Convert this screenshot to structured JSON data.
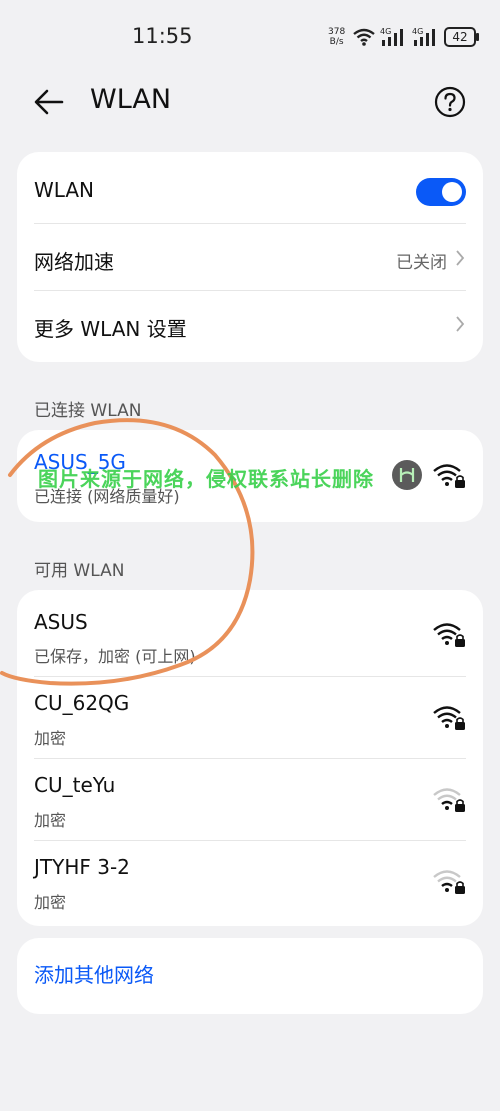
{
  "status": {
    "time": "11:55",
    "speed_value": "378",
    "speed_unit": "B/s",
    "net1": "4G",
    "net2": "4G",
    "battery": "42"
  },
  "header": {
    "title": "WLAN"
  },
  "settings": [
    {
      "label": "WLAN",
      "toggle_on": true
    },
    {
      "label": "网络加速",
      "value": "已关闭"
    },
    {
      "label": "更多 WLAN 设置"
    }
  ],
  "connected": {
    "title": "已连接 WLAN",
    "network": {
      "ssid": "ASUS_5G",
      "status": "已连接 (网络质量好)"
    }
  },
  "available": {
    "title": "可用 WLAN",
    "networks": [
      {
        "ssid": "ASUS",
        "status": "已保存，加密 (可上网)"
      },
      {
        "ssid": "CU_62QG",
        "status": "加密"
      },
      {
        "ssid": "CU_teYu",
        "status": "加密"
      },
      {
        "ssid": "JTYHF 3-2",
        "status": "加密"
      }
    ]
  },
  "add_network": "添加其他网络",
  "watermark": "图片来源于网络，侵权联系站长删除",
  "colors": {
    "accent": "#0a59f7",
    "background": "#f1f1f3",
    "annotation": "#e9915a",
    "watermark": "#38d04a"
  }
}
